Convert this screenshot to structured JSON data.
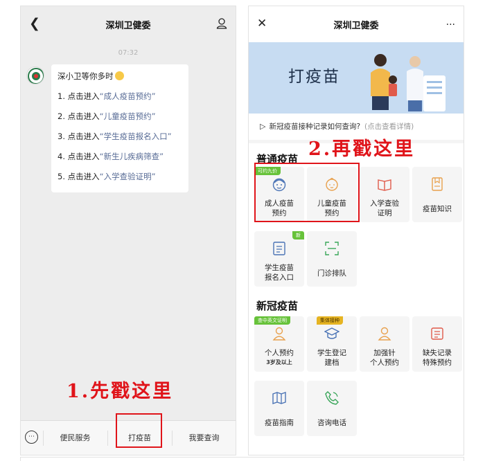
{
  "left_screen": {
    "title": "深圳卫健委",
    "timestamp": "07:32",
    "message": {
      "greeting": "深小卫等你多时",
      "lines": [
        {
          "prefix": "1. 点击进入",
          "link": "“成人疫苗预约”"
        },
        {
          "prefix": "2. 点击进入",
          "link": "“儿童疫苗预约”"
        },
        {
          "prefix": "3. 点击进入",
          "link": "“学生疫苗报名入口”"
        },
        {
          "prefix": "4. 点击进入",
          "link": "“新生儿疾病筛查”"
        },
        {
          "prefix": "5. 点击进入",
          "link": "“入学查验证明”"
        }
      ]
    },
    "menu": [
      "便民服务",
      "打疫苗",
      "我要查询"
    ],
    "annotation": "1.先戳这里"
  },
  "right_screen": {
    "title": "深圳卫健委",
    "banner_title": "打疫苗",
    "notice": "新冠疫苗接种记录如何查询?",
    "notice_hint": "(点击查看详情)",
    "annotation": "2.再戳这里",
    "sections": [
      {
        "title": "普通疫苗",
        "tiles": [
          {
            "line1": "成人疫苗",
            "line2": "预约",
            "badge": "可约九价",
            "icon": "adult-face-icon"
          },
          {
            "line1": "儿童疫苗",
            "line2": "预约",
            "icon": "baby-face-icon"
          },
          {
            "line1": "入学查验",
            "line2": "证明",
            "icon": "book-icon"
          },
          {
            "line1": "疫苗知识",
            "line2": "",
            "icon": "knowledge-doc-icon"
          },
          {
            "line1": "学生疫苗",
            "line2": "报名入口",
            "badge": "新",
            "icon": "form-icon"
          },
          {
            "line1": "门诊排队",
            "line2": "",
            "icon": "scan-icon"
          }
        ]
      },
      {
        "title": "新冠疫苗",
        "tiles": [
          {
            "line1": "个人预约",
            "line2": "3岁及以上",
            "badge": "查中英文证明",
            "icon": "person-icon"
          },
          {
            "line1": "学生登记",
            "line2": "建档",
            "badge": "集体接种",
            "icon": "graduation-cap-icon"
          },
          {
            "line1": "加强针",
            "line2": "个人预约",
            "icon": "person-icon"
          },
          {
            "line1": "缺失记录",
            "line2": "特殊预约",
            "icon": "record-icon"
          },
          {
            "line1": "疫苗指南",
            "line2": "",
            "icon": "map-icon"
          },
          {
            "line1": "咨询电话",
            "line2": "",
            "icon": "phone-icon"
          }
        ]
      }
    ]
  },
  "colors": {
    "accent_green": "#67c23a",
    "annotation_red": "#e0141a",
    "banner_blue": "#c7dcf2",
    "icon_orange": "#e8a04c"
  }
}
